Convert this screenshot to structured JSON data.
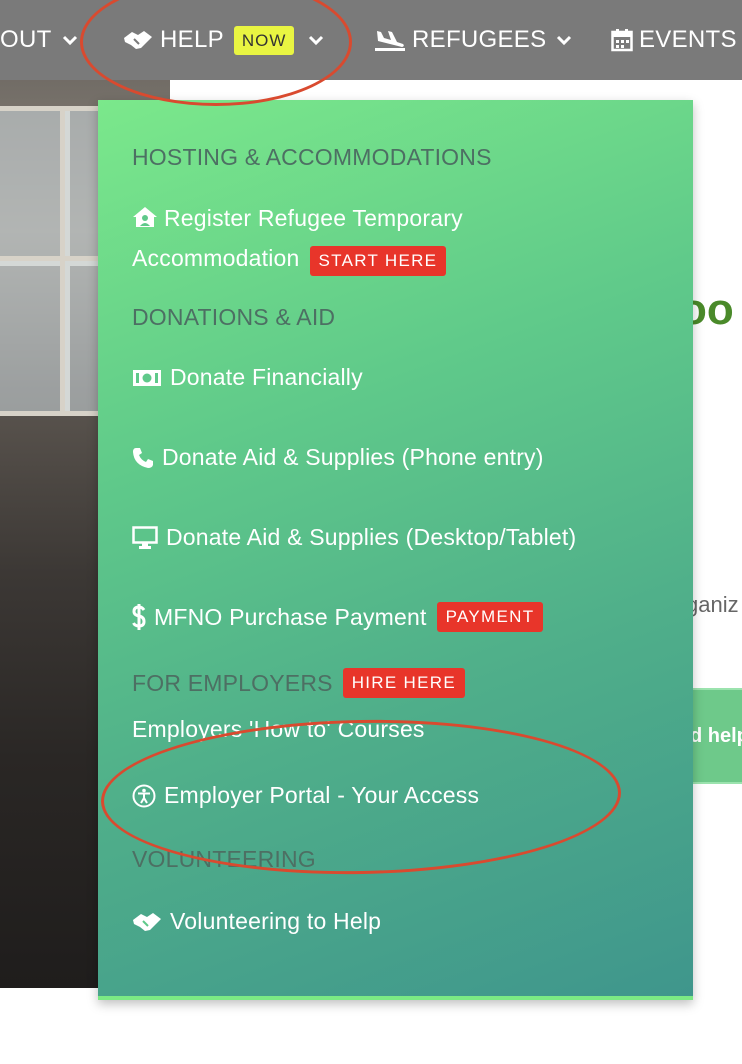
{
  "nav": {
    "items": [
      {
        "label": "OUT",
        "icon": "chevron-down-icon"
      },
      {
        "label": "HELP",
        "badge": "NOW",
        "icon": "handshake-icon"
      },
      {
        "label": "REFUGEES",
        "icon": "plane-landing-icon"
      },
      {
        "label": "EVENTS",
        "icon": "calendar-icon"
      }
    ]
  },
  "background": {
    "heading_fragment": "oo",
    "text_fragment": "ganiz",
    "banner_fragment": "d help"
  },
  "menu": {
    "hosting": {
      "heading": "HOSTING & ACCOMMODATIONS",
      "register_label": "Register Refugee Temporary Accommodation",
      "register_badge": "START HERE"
    },
    "donations": {
      "heading": "DONATIONS & AID",
      "financial_label": "Donate Financially",
      "phone_label": "Donate Aid & Supplies (Phone entry)",
      "desktop_label": "Donate Aid & Supplies (Desktop/Tablet)",
      "payment_label": "MFNO Purchase Payment",
      "payment_badge": "PAYMENT"
    },
    "employers": {
      "heading": "FOR EMPLOYERS",
      "badge": "HIRE HERE",
      "courses_label": "Employers 'How to' Courses",
      "portal_label": "Employer Portal - Your Access"
    },
    "volunteering": {
      "heading": "VOLUNTEERING",
      "help_label": "Volunteering to Help"
    }
  },
  "colors": {
    "navbar": "#7a7a7a",
    "dropdown_top": "#7be88b",
    "dropdown_bottom": "#3f968c",
    "badge_red": "#e8352a",
    "badge_yellow": "#e9f542",
    "annotation": "#d94a2f"
  }
}
